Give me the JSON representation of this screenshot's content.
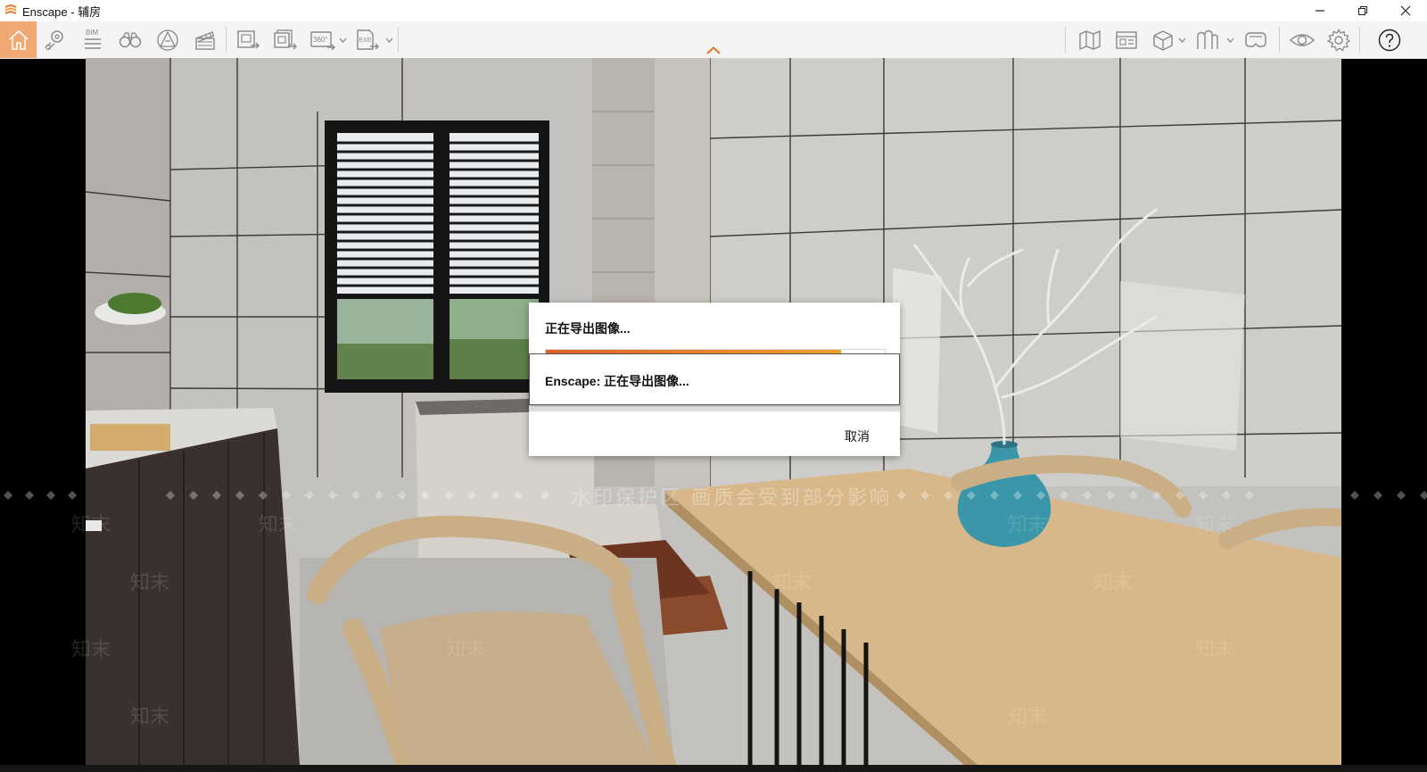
{
  "window": {
    "title": "Enscape - 辅房",
    "controls": [
      "minimize-icon",
      "restore-icon",
      "close-icon"
    ]
  },
  "toolbar": {
    "bim_label": "BIM",
    "pano_label": "360°",
    "exe_label": "EXE",
    "left_icons": [
      "home-icon",
      "location-pin-icon",
      "bim-icon",
      "binoculars-icon",
      "atmosphere-icon",
      "clapperboard-icon",
      "screenshot-export-icon",
      "batch-render-icon",
      "panorama-icon",
      "exe-export-icon"
    ],
    "right_icons": [
      "map-icon",
      "view-management-icon",
      "box-icon",
      "asset-library-icon",
      "vr-headset-icon",
      "eye-icon",
      "gear-icon",
      "help-icon"
    ],
    "accent_color": "#f2a873"
  },
  "dialog": {
    "title": "正在导出图像...",
    "progress": 0.87,
    "status": "Enscape: 正在导出图像...",
    "cancel_label": "取消"
  },
  "watermark": {
    "banner": "水印保护区  画质会受到部分影响",
    "mark": "知末"
  }
}
